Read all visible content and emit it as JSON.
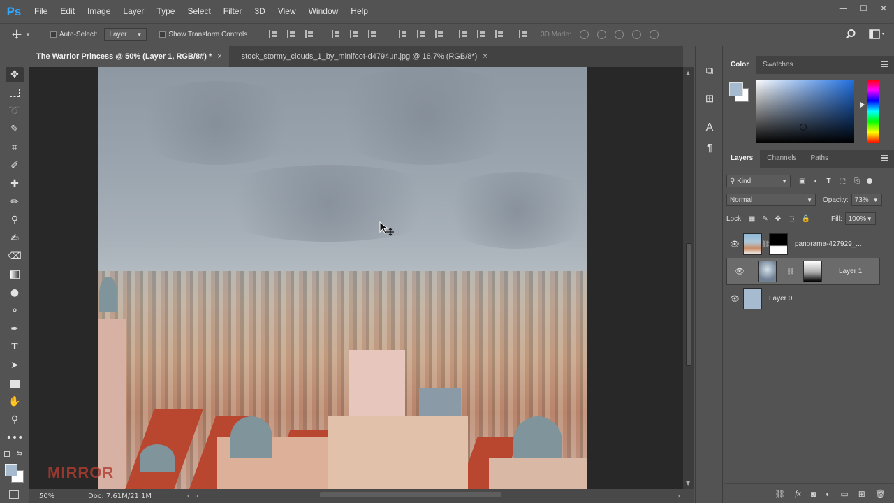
{
  "app": {
    "logo": "Ps"
  },
  "menu": [
    "File",
    "Edit",
    "Image",
    "Layer",
    "Type",
    "Select",
    "Filter",
    "3D",
    "View",
    "Window",
    "Help"
  ],
  "window_controls": {
    "minimize": "—",
    "maximize": "☐",
    "close": "✕"
  },
  "options": {
    "auto_select_label": "Auto-Select:",
    "auto_select_value": "Layer",
    "show_transform_label": "Show Transform Controls",
    "mode3d_label": "3D Mode:"
  },
  "tabs": [
    {
      "label": "The Warrior Princess @ 50% (Layer 1, RGB/8#) *",
      "close": "×"
    },
    {
      "label": "stock_stormy_clouds_1_by_minifoot-d4794un.jpg @ 16.7% (RGB/8*)",
      "close": "×"
    }
  ],
  "status": {
    "zoom": "50%",
    "doc": "Doc: 7.61M/21.1M"
  },
  "watermark": "MIRROR",
  "color_panel": {
    "tabs": [
      "Color",
      "Swatches"
    ],
    "fg_color": "#a6bbd0",
    "bg_color": "#ffffff"
  },
  "layers_panel": {
    "tabs": [
      "Layers",
      "Channels",
      "Paths"
    ],
    "kind_label": "Kind",
    "blend_mode": "Normal",
    "opacity_label": "Opacity:",
    "opacity_value": "73%",
    "lock_label": "Lock:",
    "fill_label": "Fill:",
    "fill_value": "100%",
    "layers": [
      {
        "name": "panorama-427929_...",
        "visible": true,
        "has_mask": true,
        "selected": false
      },
      {
        "name": "Layer 1",
        "visible": true,
        "has_mask": true,
        "selected": true
      },
      {
        "name": "Layer 0",
        "visible": true,
        "has_mask": false,
        "selected": false
      }
    ]
  },
  "icon_strip": [
    "A",
    "¶"
  ]
}
